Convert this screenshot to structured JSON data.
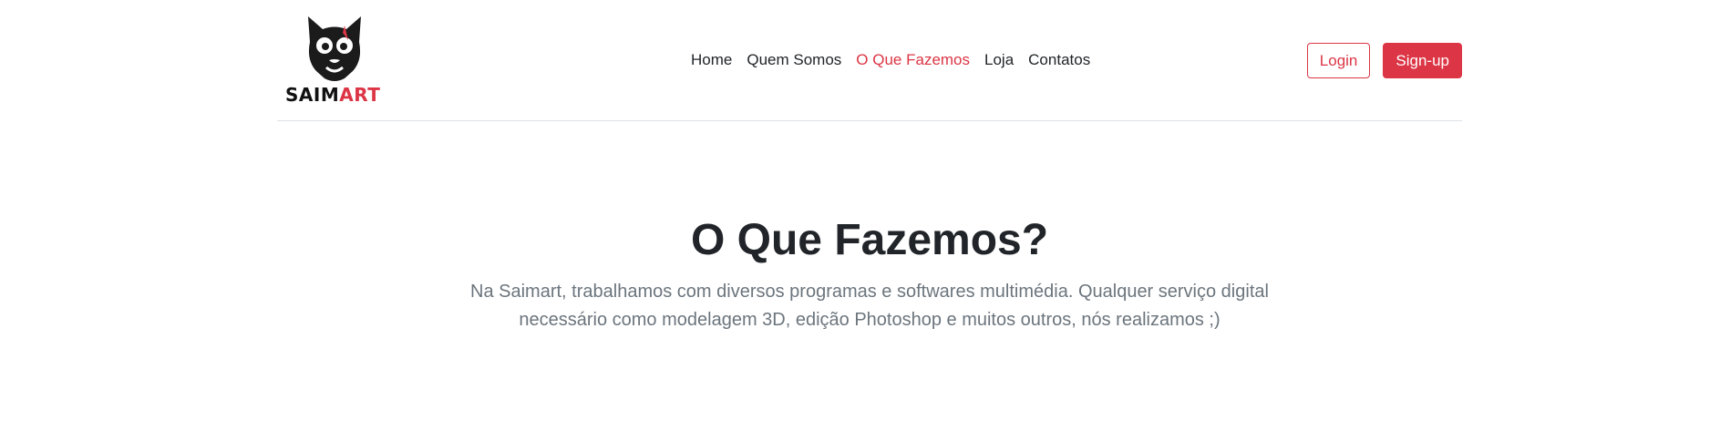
{
  "brand": {
    "logo_icon": "cat-face-icon",
    "name_part1": "SAIM",
    "name_part2": "ART",
    "accent_color": "#dc3545"
  },
  "nav": {
    "items": [
      {
        "label": "Home"
      },
      {
        "label": "Quem Somos"
      },
      {
        "label": "O Que Fazemos"
      },
      {
        "label": "Loja"
      },
      {
        "label": "Contatos"
      }
    ],
    "active_index": 2
  },
  "auth": {
    "login_label": "Login",
    "signup_label": "Sign-up"
  },
  "hero": {
    "title": "O Que Fazemos?",
    "description": "Na Saimart, trabalhamos com diversos programas e softwares multimédia. Qualquer serviço digital necessário como modelagem 3D, edição Photoshop e muitos outros, nós realizamos ;)"
  }
}
